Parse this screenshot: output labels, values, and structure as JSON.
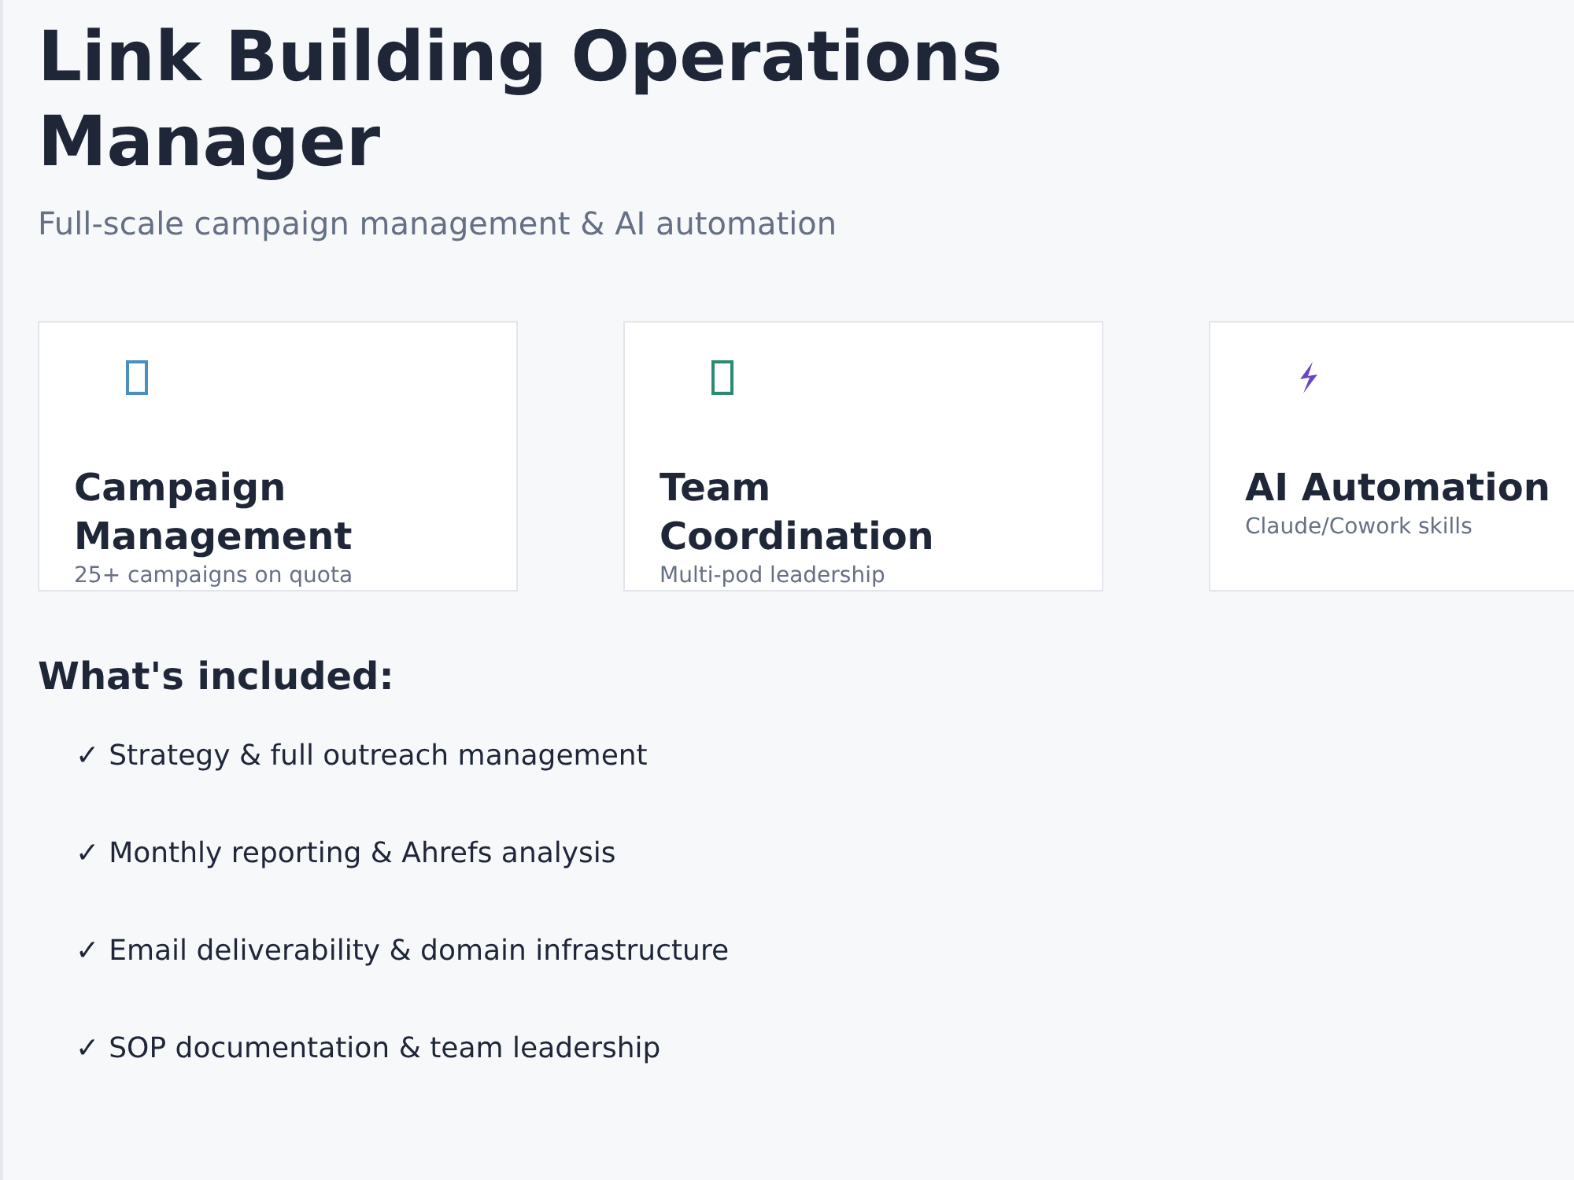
{
  "title": "Link Building Operations Manager",
  "subtitle": "Full-scale campaign management & AI automation",
  "cards": [
    {
      "kind": "box",
      "color": "#4a8fbd",
      "title": "Campaign Management",
      "subtitle": "25+ campaigns on quota"
    },
    {
      "kind": "box",
      "color": "#2b8a72",
      "title": "Team Coordination",
      "subtitle": "Multi-pod leadership"
    },
    {
      "kind": "bolt",
      "color": "#6b46c1",
      "title": "AI Automation",
      "subtitle": "Claude/Cowork skills"
    }
  ],
  "included": {
    "heading": "What's included:",
    "items": [
      {
        "check": "✓",
        "text": "Strategy & full outreach management"
      },
      {
        "check": "✓",
        "text": "Monthly reporting & Ahrefs analysis"
      },
      {
        "check": "✓",
        "text": "Email deliverability & domain infrastructure"
      },
      {
        "check": "✓",
        "text": "SOP documentation & team leadership"
      }
    ]
  }
}
